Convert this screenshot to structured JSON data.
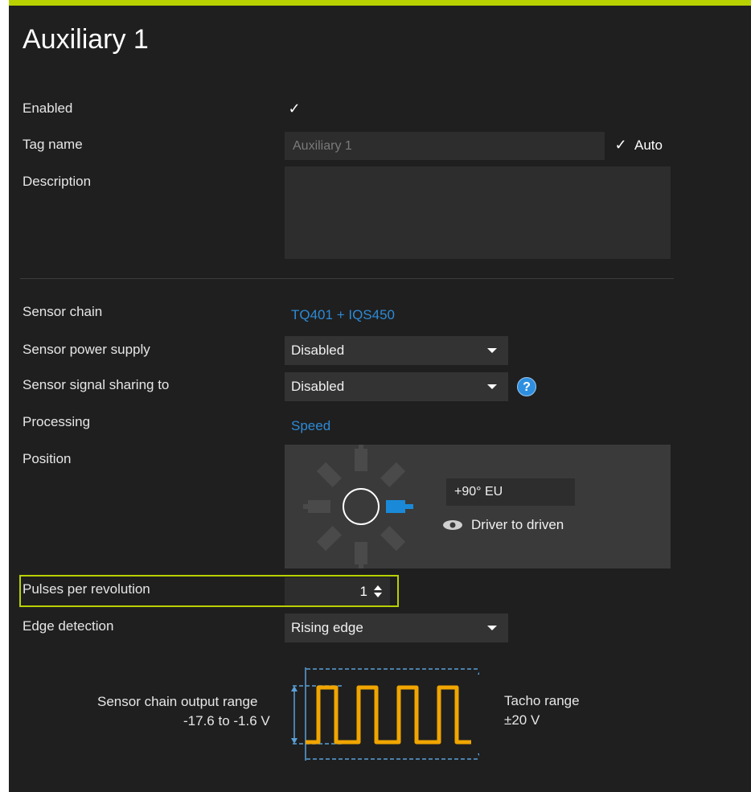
{
  "title": "Auxiliary 1",
  "fields": {
    "enabled_label": "Enabled",
    "enabled_checked": true,
    "tag_name_label": "Tag name",
    "tag_name_value": "Auxiliary 1",
    "auto_label": "Auto",
    "auto_checked": true,
    "description_label": "Description",
    "description_value": "",
    "sensor_chain_label": "Sensor chain",
    "sensor_chain_value": "TQ401 + IQS450",
    "sensor_power_label": "Sensor power supply",
    "sensor_power_value": "Disabled",
    "sensor_sharing_label": "Sensor signal sharing to",
    "sensor_sharing_value": "Disabled",
    "processing_label": "Processing",
    "processing_value": "Speed",
    "position_label": "Position",
    "position_value": "+90° EU",
    "position_link": "Driver to driven",
    "pulses_label": "Pulses per revolution",
    "pulses_value": "1",
    "edge_label": "Edge detection",
    "edge_value": "Rising edge"
  },
  "diagram": {
    "output_range_label": "Sensor chain output range",
    "output_range_value": "-17.6 to -1.6 V",
    "tacho_range_label": "Tacho range",
    "tacho_range_value": "±20 V",
    "signal_color": "#f0a500",
    "dim_color": "#5aa0d8"
  },
  "colors": {
    "accent": "#b8d100",
    "link": "#2d8ad6",
    "panel_bg": "#1f1f1f"
  },
  "icons": {
    "check": "checkmark-icon",
    "help": "question-mark-icon",
    "eye": "eye-icon",
    "caret": "chevron-down-icon",
    "stepper": "up-down-arrows-icon"
  }
}
